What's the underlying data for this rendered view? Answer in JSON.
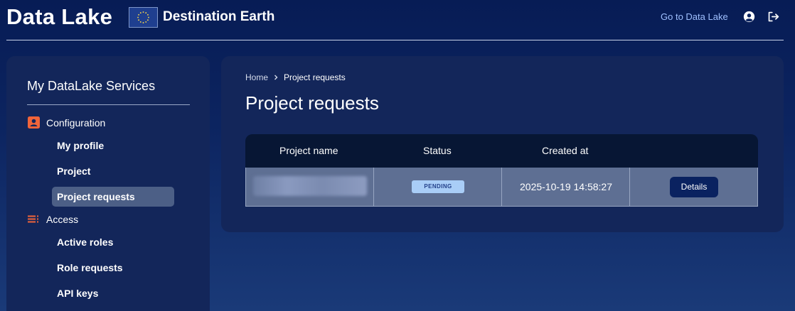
{
  "header": {
    "brand_title": "Data Lake",
    "partner_name": "Destination Earth",
    "go_link": "Go to Data Lake",
    "icons": [
      "eu-flag-icon",
      "user-circle-icon",
      "logout-icon"
    ]
  },
  "sidebar": {
    "title": "My DataLake Services",
    "sections": [
      {
        "label": "Configuration",
        "icon": "user-card-icon",
        "icon_color": "#f0643a",
        "items": [
          {
            "label": "My profile",
            "active": false
          },
          {
            "label": "Project",
            "active": false
          },
          {
            "label": "Project requests",
            "active": true
          }
        ]
      },
      {
        "label": "Access",
        "icon": "list-icon",
        "icon_color": "#f0643a",
        "items": [
          {
            "label": "Active roles",
            "active": false
          },
          {
            "label": "Role requests",
            "active": false
          },
          {
            "label": "API keys",
            "active": false
          }
        ]
      }
    ]
  },
  "main": {
    "breadcrumb": {
      "home": "Home",
      "current": "Project requests"
    },
    "page_title": "Project requests",
    "table": {
      "columns": [
        "Project name",
        "Status",
        "Created at"
      ],
      "rows": [
        {
          "project_name": "",
          "status": "PENDING",
          "created_at": "2025-10-19 14:58:27",
          "action": "Details"
        }
      ]
    }
  },
  "colors": {
    "background": "#0c2460",
    "card": "#13265a",
    "accent_link": "#9fc0ff",
    "status_pending_bg": "#a9cdf7",
    "status_pending_text": "#23408a",
    "section_icon": "#f0643a"
  }
}
